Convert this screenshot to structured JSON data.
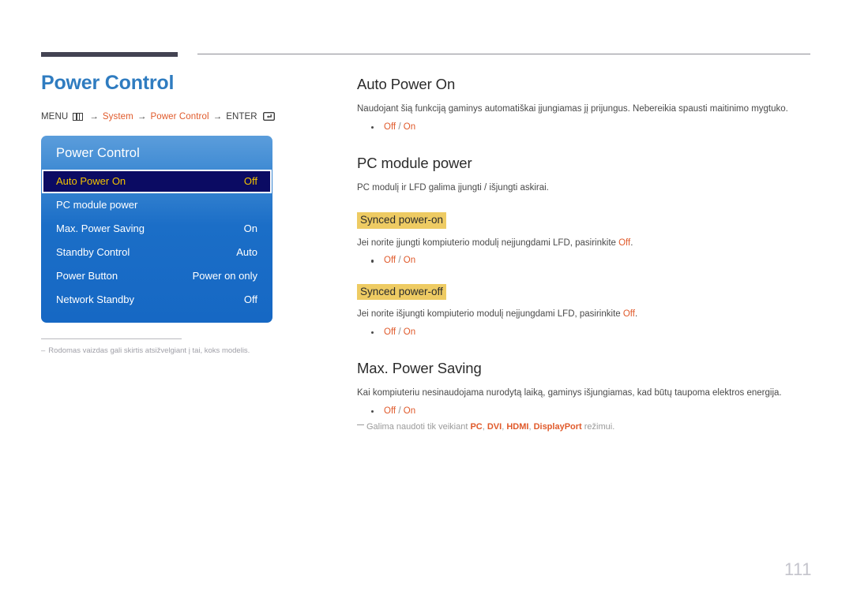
{
  "header": {
    "rule_accent_color": "#434352",
    "rule_line_color": "#8d8d95"
  },
  "left": {
    "page_title": "Power Control",
    "breadcrumb": {
      "menu_label": "MENU",
      "menu_icon": "menu-grid-icon",
      "arrow": "→",
      "item1": "System",
      "item2": "Power Control",
      "enter_label": "ENTER",
      "enter_icon": "enter-key-icon"
    },
    "osd": {
      "title": "Power Control",
      "rows": [
        {
          "label": "Auto Power On",
          "value": "Off",
          "selected": true
        },
        {
          "label": "PC module power",
          "value": "",
          "selected": false
        },
        {
          "label": "Max. Power Saving",
          "value": "On",
          "selected": false
        },
        {
          "label": "Standby Control",
          "value": "Auto",
          "selected": false
        },
        {
          "label": "Power Button",
          "value": "Power on only",
          "selected": false
        },
        {
          "label": "Network Standby",
          "value": "Off",
          "selected": false
        }
      ],
      "selected_bg": "#0b0b63",
      "selected_text": "#f2c200",
      "panel_blue": "#1668c4"
    },
    "note": {
      "dash": "–",
      "text": "Rodomas vaizdas gali skirtis atsižvelgiant į tai, koks modelis."
    }
  },
  "right": {
    "sections": [
      {
        "title": "Auto Power On",
        "body": "Naudojant šią funkciją gaminys automatiškai įjungiamas jį prijungus. Nebereikia spausti maitinimo mygtuko.",
        "option_off": "Off",
        "option_sep": "/",
        "option_on": "On"
      },
      {
        "title": "PC module power",
        "body": "PC modulį ir LFD galima įjungti / išjungti askirai."
      },
      {
        "badge": "Synced power-on",
        "body_pre": "Jei norite įjungti kompiuterio modulį neįjungdami LFD, pasirinkite ",
        "body_accent": "Off",
        "body_post": ".",
        "option_off": "Off",
        "option_sep": "/",
        "option_on": "On"
      },
      {
        "badge": "Synced power-off",
        "body_pre": "Jei norite išjungti kompiuterio modulį neįjungdami LFD, pasirinkite ",
        "body_accent": "Off",
        "body_post": ".",
        "option_off": "Off",
        "option_sep": "/",
        "option_on": "On"
      },
      {
        "title": "Max. Power Saving",
        "body": "Kai kompiuteriu nesinaudojama nurodytą laiką, gaminys išjungiamas, kad būtų taupoma elektros energija.",
        "option_off": "Off",
        "option_sep": "/",
        "option_on": "On",
        "footnote_pre": "Galima naudoti tik veikiant ",
        "footnote_modes": [
          "PC",
          "DVI",
          "HDMI",
          "DisplayPort"
        ],
        "footnote_post": " režimui."
      }
    ]
  },
  "page_number": "111",
  "colors": {
    "title_blue": "#2f7cc0",
    "accent_orange": "#e05a2b",
    "badge_yellow": "#eecb63",
    "page_number_gray": "#c4c4cc"
  }
}
